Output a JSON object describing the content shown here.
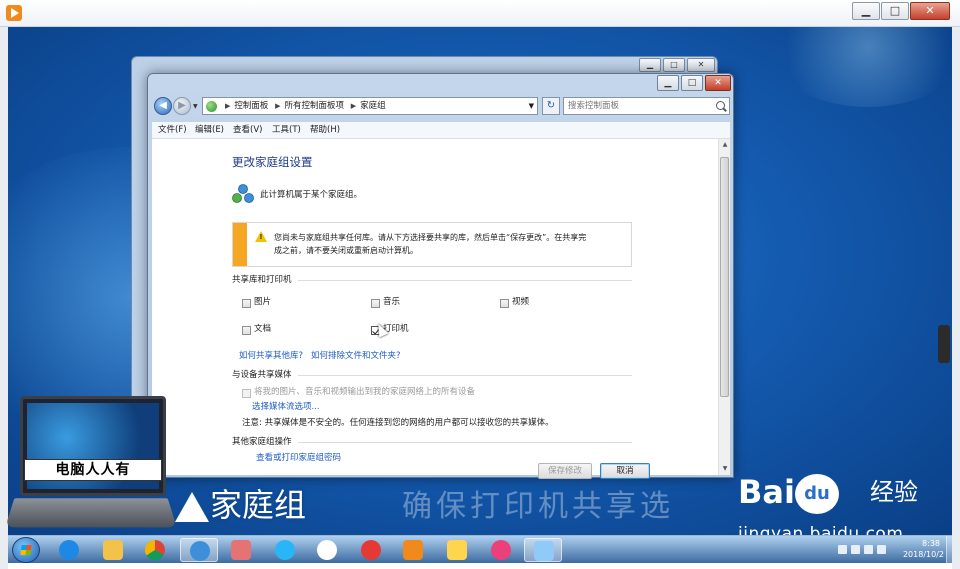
{
  "colors": {
    "accent": "#1f5cc4",
    "title": "#1e3a8a",
    "warning": "#f5a623",
    "desktop": "#145bb0"
  },
  "window": {
    "minimize": "▁",
    "maximize": "□",
    "close": "✕"
  },
  "address": {
    "segments": [
      "控制面板",
      "所有控制面板项",
      "家庭组"
    ],
    "search_placeholder": "搜索控制面板"
  },
  "menu": [
    "文件(F)",
    "编辑(E)",
    "查看(V)",
    "工具(T)",
    "帮助(H)"
  ],
  "content": {
    "title": "更改家庭组设置",
    "membership": "此计算机属于某个家庭组。",
    "warning_line1": "您尚未与家庭组共享任何库。请从下方选择要共享的库，然后单击“保存更改”。在共享完",
    "warning_line2": "成之前，请不要关闭或重新启动计算机。",
    "share_section": "共享库和打印机",
    "libraries": [
      {
        "label": "图片",
        "checked": false
      },
      {
        "label": "音乐",
        "checked": false
      },
      {
        "label": "视频",
        "checked": false
      },
      {
        "label": "文档",
        "checked": false
      },
      {
        "label": "打印机",
        "checked": true
      }
    ],
    "link_share_other": "如何共享其他库?",
    "link_exclude": "如何排除文件和文件夹?",
    "media_section": "与设备共享媒体",
    "media_checkbox": "将我的图片、音乐和视频输出到我的家庭网络上的所有设备",
    "media_link": "选择媒体流选项...",
    "media_note": "注意: 共享媒体是不安全的。任何连接到您的网络的用户都可以接收您的共享媒体。",
    "other_section": "其他家庭组操作",
    "other_link": "查看或打印家庭组密码"
  },
  "buttons": {
    "save": "保存修改",
    "cancel": "取消"
  },
  "watermark": {
    "laptop_label": "电脑人人有",
    "caption": "家庭组",
    "subtitle": "确保打印机共享选",
    "baidu_brand": "Bai",
    "baidu_du": "du",
    "baidu_jingyan": "经验",
    "baidu_url": "jingyan.baidu.com"
  },
  "taskbar": {
    "icons": [
      "ie-icon",
      "explorer-icon",
      "chrome-icon",
      "homegroup-icon",
      "paint-icon",
      "edge-icon",
      "pinwheel-icon",
      "jiang-icon",
      "player-icon",
      "folder-icon",
      "face-icon",
      "remote-icon"
    ],
    "time": "8:38",
    "date": "2018/10/2"
  }
}
